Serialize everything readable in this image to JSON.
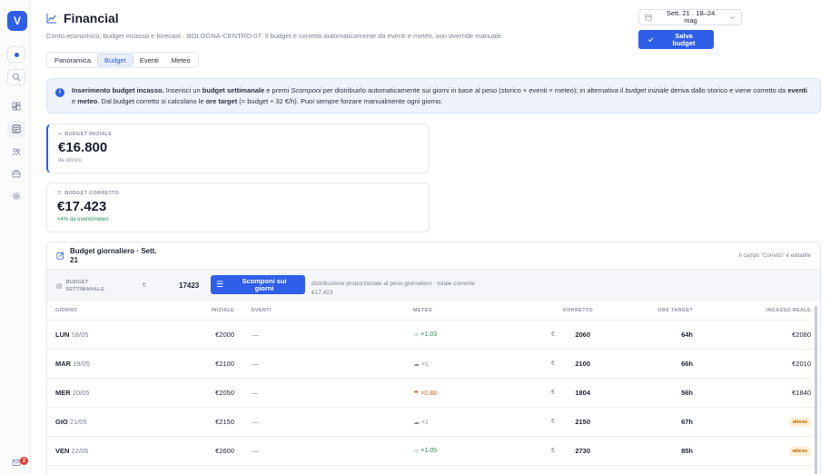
{
  "sidebar": {
    "logo": "V",
    "notif_count": "2"
  },
  "header": {
    "title": "Financial",
    "subtitle": "Conto economico, budget incasso e forecast · BOLOGNA-CENTRO-07. Il budget è corretto automaticamente da eventi e meteo, con override manuale.",
    "week_line1": "Sett. 21 · 18–24",
    "week_line2": "mag",
    "save_line1": "Salva",
    "save_line2": "budget"
  },
  "tabs": [
    "Panoramica",
    "Budget",
    "Eventi",
    "Meteo"
  ],
  "info": {
    "t1": "Inserimento budget incasso.",
    "t2": " Inserisci un ",
    "t3": "budget settimanale",
    "t4": " e premi ",
    "t5": "Scomponi",
    "t6": " per distribuirlo automaticamente sui giorni in base al peso (storico × eventi × meteo); in alternativa il ",
    "t7": "budget iniziale",
    "t8": " deriva dallo storico e viene corretto da ",
    "t9": "eventi",
    "t10": " e ",
    "t11": "meteo",
    "t12": ". Dal budget corretto si calcolano le ",
    "t13": "ore target",
    "t14": " (= budget ÷ 32 €/h). Puoi sempre forzare manualmente ogni giorno."
  },
  "kpi_initial": {
    "label": "BUDGET INIZIALE",
    "value": "€16.800",
    "sub": "da storico"
  },
  "kpi_corrected": {
    "label": "BUDGET CORRETTO",
    "value": "€17.423",
    "sub": "+4% da eventi/meteo"
  },
  "table_card": {
    "title_line1": "Budget giornaliero · Sett.",
    "title_line2": "21",
    "hint": "Il campo \"Corretto\" è editabile",
    "weekly_label1": "BUDGET",
    "weekly_label2": "SETTIMANALE",
    "currency": "€",
    "weekly_value": "17423",
    "split_line1": "Scomponi sui",
    "split_line2": "giorni",
    "note_line1": "distribuzione proporzionale al peso giornaliero · totale corrente",
    "note_line2": "€17.423"
  },
  "columns": [
    "GIORNO",
    "INIZIALE",
    "EVENTI",
    "METEO",
    "CORRETTO",
    "ORE TARGET",
    "INCASSO REALE"
  ],
  "rows": [
    {
      "day": "LUN",
      "date": "18/05",
      "initial": "€2000",
      "events": "—",
      "weather": "☼ ×1.03",
      "corrected": "2060",
      "hours": "64h",
      "actual": "€2080"
    },
    {
      "day": "MAR",
      "date": "19/05",
      "initial": "€2100",
      "events": "—",
      "weather": "☁ ×1",
      "corrected": "2100",
      "hours": "66h",
      "actual": "€2010"
    },
    {
      "day": "MER",
      "date": "20/05",
      "initial": "€2050",
      "events": "—",
      "weather": "☂ ×0.88",
      "corrected": "1804",
      "hours": "56h",
      "actual": "€1840"
    },
    {
      "day": "GIO",
      "date": "21/05",
      "initial": "€2150",
      "events": "—",
      "weather": "☁ ×1",
      "corrected": "2150",
      "hours": "67h",
      "actual": "atteso"
    },
    {
      "day": "VEN",
      "date": "22/05",
      "initial": "€2600",
      "events": "—",
      "weather": "☼ ×1.05",
      "corrected": "2730",
      "hours": "85h",
      "actual": "atteso"
    }
  ],
  "colors": {
    "accent": "#2f5ee8",
    "green": "#2e8b57",
    "orange": "#d4661c",
    "pending": "#fdeed4"
  }
}
